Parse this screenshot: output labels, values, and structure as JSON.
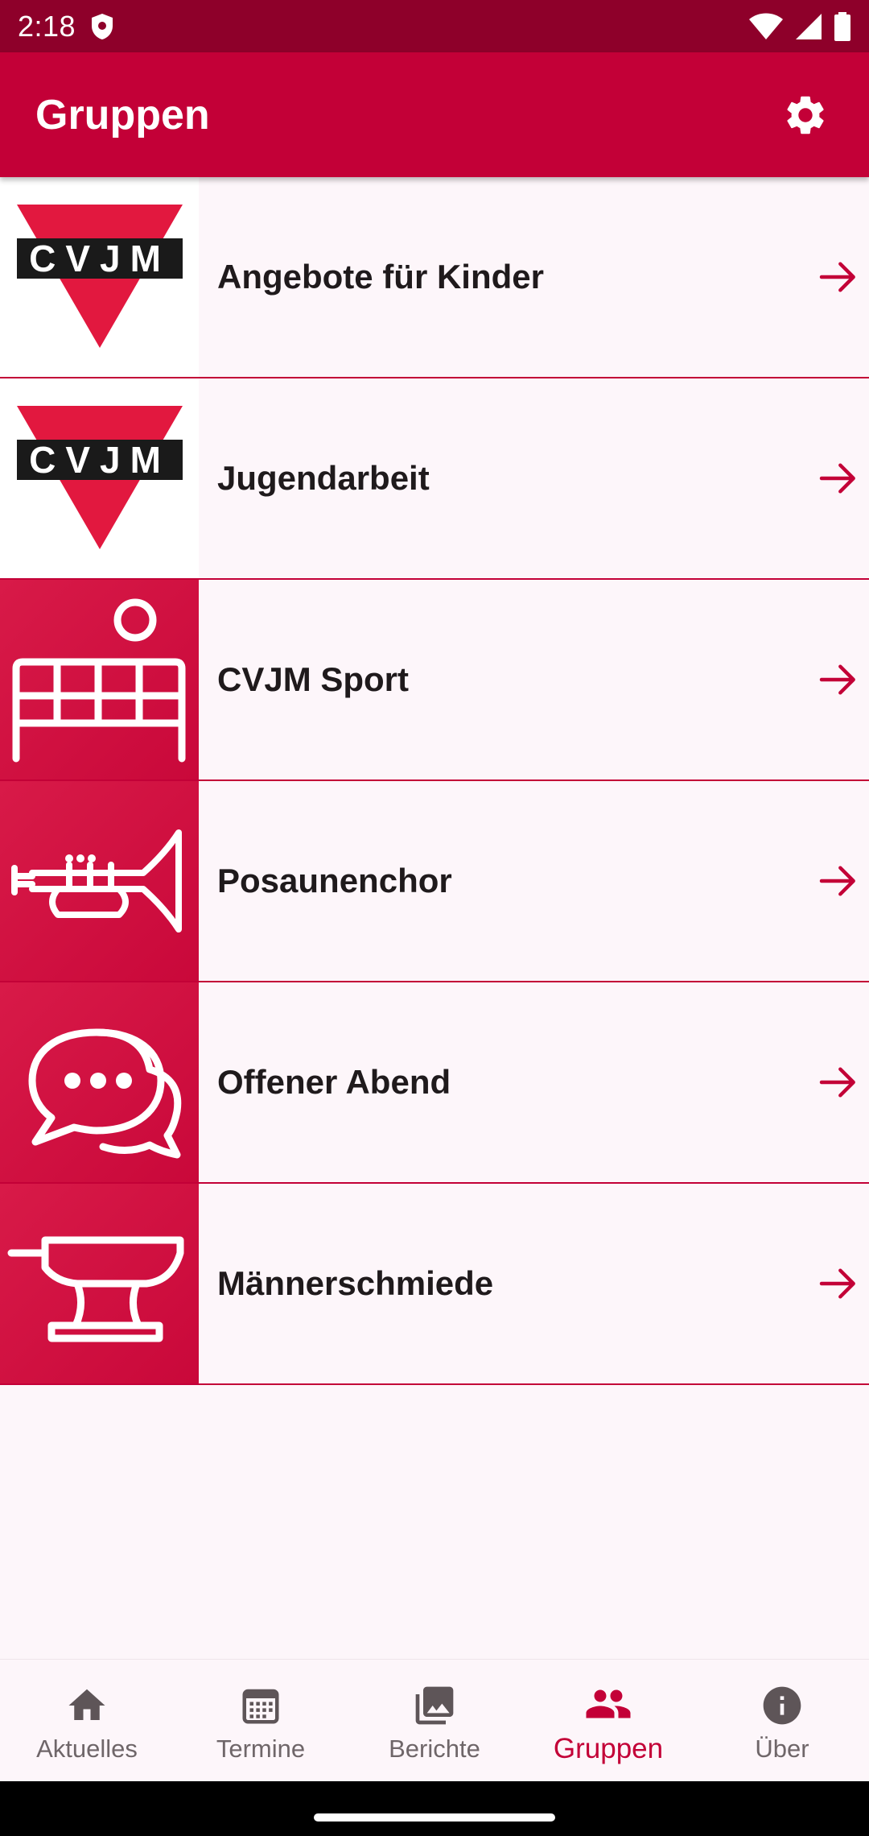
{
  "status_bar": {
    "time": "2:18",
    "icons": [
      "shield-icon",
      "wifi-icon",
      "signal-icon",
      "battery-icon"
    ]
  },
  "app_bar": {
    "title": "Gruppen",
    "action_icon": "settings-icon"
  },
  "groups": [
    {
      "label": "Angebote für Kinder",
      "thumb": "cvjm-logo",
      "logo_text": "CVJM"
    },
    {
      "label": "Jugendarbeit",
      "thumb": "cvjm-logo",
      "logo_text": "CVJM"
    },
    {
      "label": "CVJM Sport",
      "thumb": "volleyball-net-icon"
    },
    {
      "label": "Posaunenchor",
      "thumb": "trumpet-icon"
    },
    {
      "label": "Offener Abend",
      "thumb": "chat-bubbles-icon"
    },
    {
      "label": "Männerschmiede",
      "thumb": "anvil-icon"
    }
  ],
  "bottom_nav": {
    "items": [
      {
        "label": "Aktuelles",
        "icon": "home-icon"
      },
      {
        "label": "Termine",
        "icon": "calendar-icon"
      },
      {
        "label": "Berichte",
        "icon": "photos-icon"
      },
      {
        "label": "Gruppen",
        "icon": "groups-icon",
        "active": true
      },
      {
        "label": "Über",
        "icon": "info-icon"
      }
    ]
  },
  "colors": {
    "primary": "#c30037",
    "status_bar": "#8e002a",
    "background": "#fdf6fa",
    "text": "#1f1a1c",
    "inactive_nav": "#6f6669"
  }
}
